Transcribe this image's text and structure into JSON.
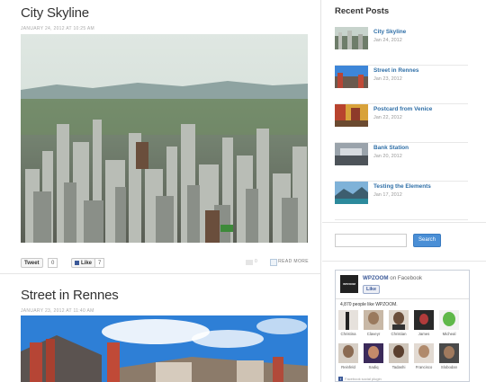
{
  "posts": [
    {
      "title": "City Skyline",
      "meta": "JANUARY 24, 2012 AT 10:25 AM"
    },
    {
      "title": "Street in Rennes",
      "meta": "JANUARY 23, 2012 AT 11:40 AM"
    }
  ],
  "share": {
    "tweet_label": "Tweet",
    "tweet_count": "0",
    "like_label": "Like",
    "like_count": "7",
    "comments_count": "0",
    "read_more": "READ MORE"
  },
  "sidebar": {
    "recent_title": "Recent Posts",
    "recent_posts": [
      {
        "title": "City Skyline",
        "date": "Jan 24, 2012"
      },
      {
        "title": "Street in Rennes",
        "date": "Jan 23, 2012"
      },
      {
        "title": "Postcard from Venice",
        "date": "Jan 22, 2012"
      },
      {
        "title": "Bank Station",
        "date": "Jan 20, 2012"
      },
      {
        "title": "Testing the Elements",
        "date": "Jan 17, 2012"
      }
    ],
    "search": {
      "placeholder": "",
      "button_label": "Search"
    }
  },
  "facebook": {
    "logo_text": "WPZOOM",
    "page_name": "WPZOOM",
    "on_facebook": " on Facebook",
    "like_label": "Like",
    "people_like": "4,870 people like WPZOOM.",
    "faces": [
      "Christina",
      "Claveyr",
      "Christian",
      "James",
      "Micheal",
      "Reinfeld",
      "Sadiq",
      "Tadashi",
      "Francisco",
      "Slobodan"
    ],
    "plugin_label": "Facebook social plugin"
  },
  "colors": {
    "link": "#2f6fa7",
    "search_button": "#4a8fd6",
    "facebook_blue": "#3b5998"
  }
}
